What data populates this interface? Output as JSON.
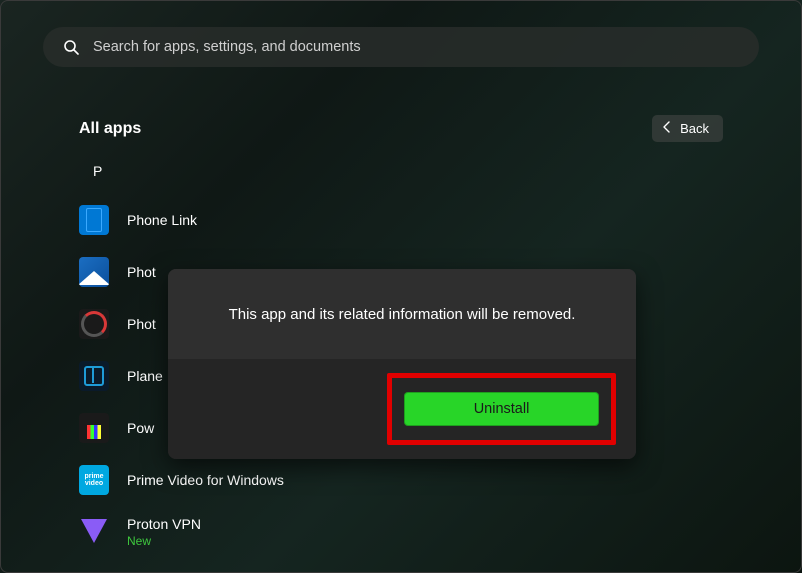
{
  "search": {
    "placeholder": "Search for apps, settings, and documents"
  },
  "header": {
    "title": "All apps",
    "back_label": "Back"
  },
  "section_letter": "P",
  "apps": [
    {
      "label": "Phone Link"
    },
    {
      "label": "Phot"
    },
    {
      "label": "Phot"
    },
    {
      "label": "Plane"
    },
    {
      "label": "Pow"
    },
    {
      "label": "Prime Video for Windows"
    },
    {
      "label": "Proton VPN",
      "sublabel": "New"
    }
  ],
  "dialog": {
    "message": "This app and its related information will be removed.",
    "uninstall_label": "Uninstall"
  }
}
